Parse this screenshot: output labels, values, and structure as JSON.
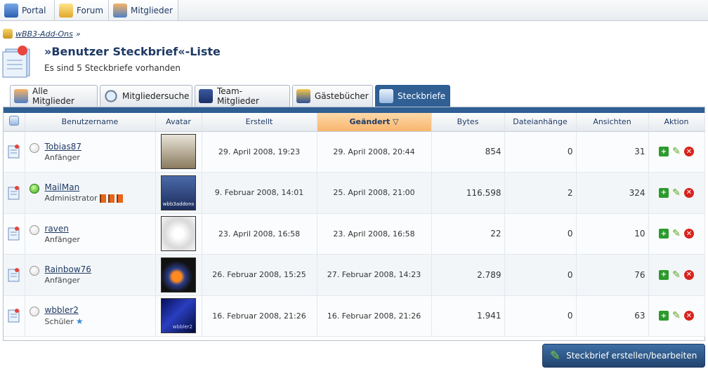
{
  "topnav": [
    {
      "label": "Portal",
      "icon": "portal-icon",
      "color": "#3b74c9"
    },
    {
      "label": "Forum",
      "icon": "folder-icon",
      "color": "#f0c64a"
    },
    {
      "label": "Mitglieder",
      "icon": "members-icon",
      "color": "#e88a2a"
    }
  ],
  "breadcrumb": {
    "item": "wBB3-Add-Ons",
    "separator": "»"
  },
  "header": {
    "title": "»Benutzer Steckbrief«-Liste",
    "subtitle": "Es sind 5 Steckbriefe vorhanden"
  },
  "tabs": [
    {
      "label": "Alle Mitglieder",
      "icon": "members-icon"
    },
    {
      "label": "Mitgliedersuche",
      "icon": "magnifier-icon"
    },
    {
      "label": "Team-Mitglieder",
      "icon": "team-icon"
    },
    {
      "label": "Gästebücher",
      "icon": "guestbook-icon"
    },
    {
      "label": "Steckbriefe",
      "icon": "profile-card-icon",
      "active": true
    }
  ],
  "table": {
    "columns": [
      "",
      "Benutzername",
      "Avatar",
      "Erstellt",
      "Geändert",
      "Bytes",
      "Dateianhänge",
      "Ansichten",
      "Aktion"
    ],
    "sorted_column": "Geändert",
    "rows": [
      {
        "name": "Tobias87",
        "rank": "Anfänger",
        "online": false,
        "flags": 0,
        "star": false,
        "created": "29. April 2008, 19:23",
        "changed": "29. April 2008, 20:44",
        "bytes": "854",
        "attachments": "0",
        "views": "31",
        "avatar_color": "#b9a98a"
      },
      {
        "name": "MailMan",
        "rank": "Administrator",
        "online": true,
        "flags": 3,
        "star": false,
        "created": "9. Februar 2008, 14:01",
        "changed": "25. April 2008, 21:00",
        "bytes": "116.598",
        "attachments": "2",
        "views": "324",
        "avatar_color": "#2c3f7a",
        "avatar_text": "wbb3addons"
      },
      {
        "name": "raven",
        "rank": "Anfänger",
        "online": false,
        "flags": 0,
        "star": false,
        "created": "23. April 2008, 16:58",
        "changed": "23. April 2008, 16:58",
        "bytes": "22",
        "attachments": "0",
        "views": "10",
        "avatar_color": "#e8e8e8"
      },
      {
        "name": "Rainbow76",
        "rank": "Anfänger",
        "online": false,
        "flags": 0,
        "star": false,
        "created": "26. Februar 2008, 15:25",
        "changed": "27. Februar 2008, 14:23",
        "bytes": "2.789",
        "attachments": "0",
        "views": "76",
        "avatar_color": "#2a2a2a"
      },
      {
        "name": "wbbler2",
        "rank": "Schüler",
        "online": false,
        "flags": 0,
        "star": true,
        "created": "16. Februar 2008, 21:26",
        "changed": "16. Februar 2008, 21:26",
        "bytes": "1.941",
        "attachments": "0",
        "views": "63",
        "avatar_color": "#1a2a7a",
        "avatar_text": "wbbler2"
      }
    ]
  },
  "create_button": "Steckbrief erstellen/bearbeiten"
}
